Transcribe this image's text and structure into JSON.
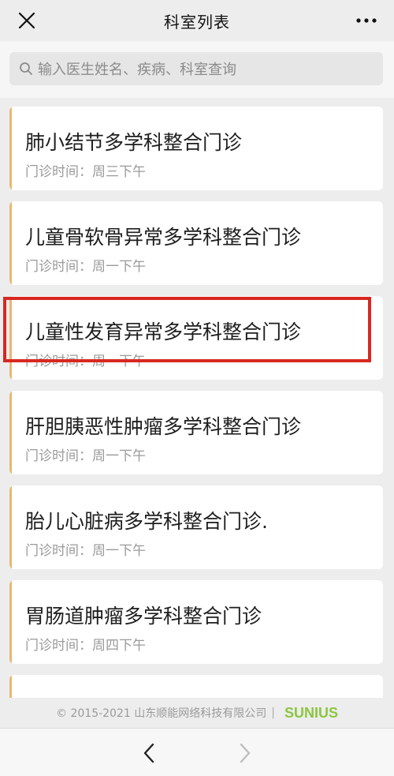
{
  "header": {
    "title": "科室列表",
    "close_icon": "close-icon",
    "more_icon": "more-icon"
  },
  "search": {
    "placeholder": "输入医生姓名、疾病、科室查询"
  },
  "accent_color": "#e8b872",
  "highlight_color": "#d72822",
  "departments": [
    {
      "name": "肺小结节多学科整合门诊",
      "time": "门诊时间：周三下午"
    },
    {
      "name": "儿童骨软骨异常多学科整合门诊",
      "time": "门诊时间：周一下午"
    },
    {
      "name": "儿童性发育异常多学科整合门诊",
      "time": "门诊时间：周一下午"
    },
    {
      "name": "肝胆胰恶性肿瘤多学科整合门诊",
      "time": "门诊时间：周一下午"
    },
    {
      "name": "胎儿心脏病多学科整合门诊.",
      "time": "门诊时间：周一下午"
    },
    {
      "name": "胃肠道肿瘤多学科整合门诊",
      "time": "门诊时间：周四下午"
    }
  ],
  "footer": {
    "copyright": "© 2015-2021 山东顺能网络科技有限公司",
    "separator": "|",
    "logo_text": "SUNIUS"
  },
  "nav": {
    "back_icon": "chevron-left-icon",
    "forward_icon": "chevron-right-icon"
  }
}
